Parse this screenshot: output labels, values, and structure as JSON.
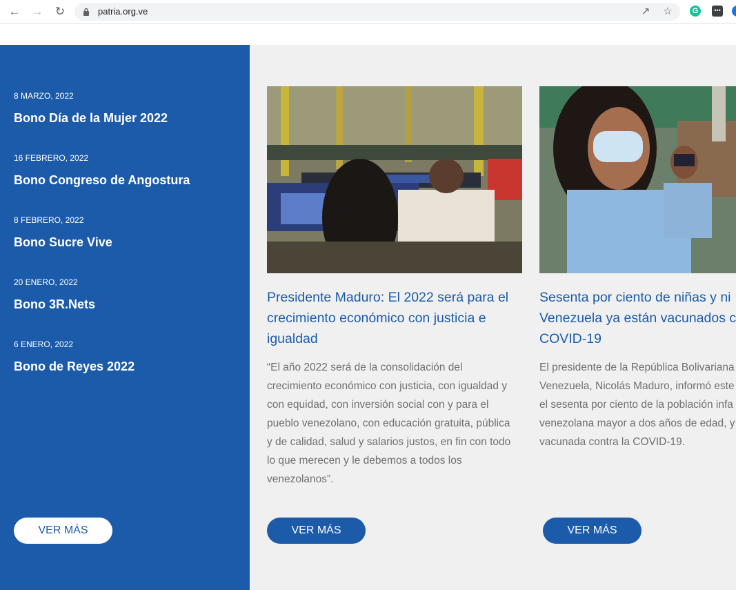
{
  "browser": {
    "url": "patria.org.ve",
    "grammarly_letter": "G"
  },
  "sidebar": {
    "items": [
      {
        "date": "8 MARZO, 2022",
        "title": "Bono Día de la Mujer 2022"
      },
      {
        "date": "16 FEBRERO, 2022",
        "title": "Bono Congreso de Angostura"
      },
      {
        "date": "8 FEBRERO, 2022",
        "title": "Bono Sucre Vive"
      },
      {
        "date": "20 ENERO, 2022",
        "title": "Bono 3R.Nets"
      },
      {
        "date": "6 ENERO, 2022",
        "title": "Bono de Reyes 2022"
      }
    ],
    "button_label": "VER MÁS"
  },
  "news": [
    {
      "title_lines": [
        "Presidente Maduro: El 2022 será para el",
        "crecimiento económico con justicia e",
        "igualdad"
      ],
      "text_lines": [
        "“El año 2022 será de la consolidación del",
        "crecimiento económico con justicia, con igualdad y",
        "con equidad, con inversión social con y para el",
        "pueblo venezolano, con educación gratuita, pública",
        "y de calidad, salud y salarios justos, en fin con todo",
        "lo que merecen y le debemos a todos los",
        "venezolanos”."
      ],
      "button_label": "VER MÁS"
    },
    {
      "title_lines": [
        "Sesenta por ciento de niñas y ni",
        "Venezuela ya están vacunados c",
        "COVID-19"
      ],
      "text_lines": [
        "El presidente de la República Bolivariana",
        "Venezuela, Nicolás Maduro, informó este",
        "el sesenta por ciento de la población infa",
        "venezolana mayor a dos años de edad, y",
        "vacunada contra la COVID-19."
      ],
      "button_label": "VER MÁS"
    }
  ],
  "colors": {
    "brand_blue": "#1b5baa",
    "panel_gray": "#f0f0f0",
    "text_gray": "#707070"
  }
}
